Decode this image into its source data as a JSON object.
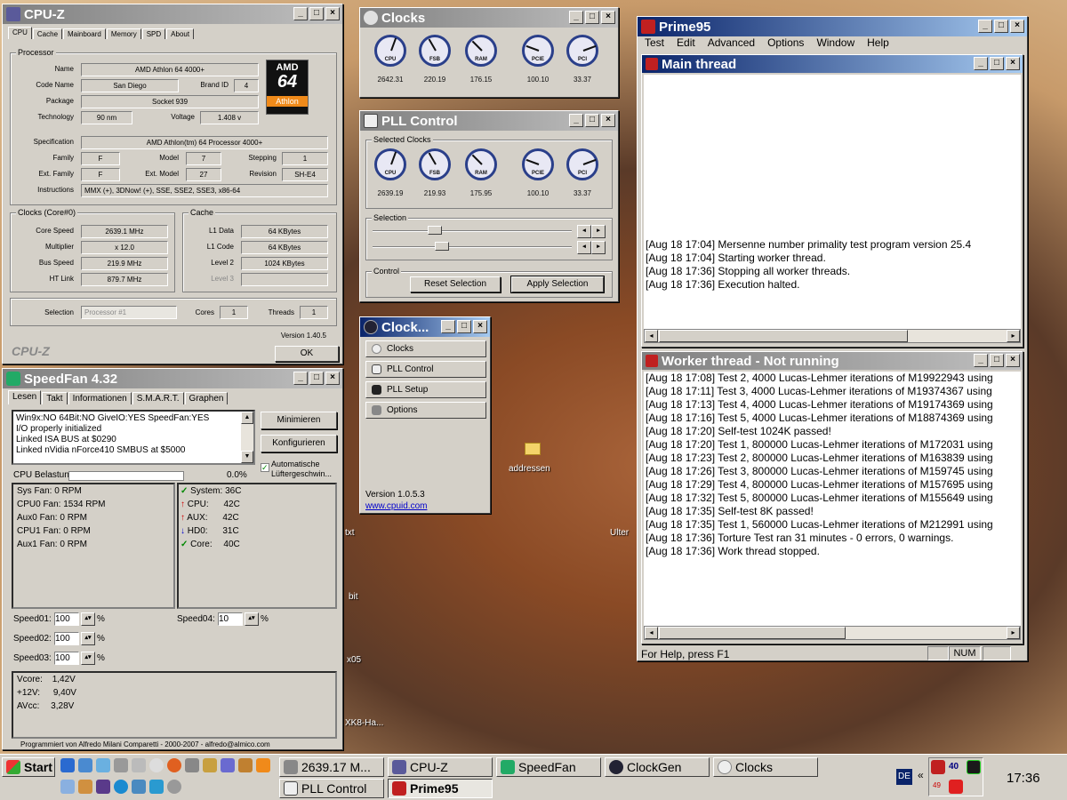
{
  "desktop": {
    "labels": [
      "addressen",
      "Ulter",
      "txt",
      "bit",
      "x05",
      "XK8-Ha..."
    ]
  },
  "cpuz": {
    "title": "CPU-Z",
    "tabs": [
      "CPU",
      "Cache",
      "Mainboard",
      "Memory",
      "SPD",
      "About"
    ],
    "processor_group": "Processor",
    "name_label": "Name",
    "name": "AMD Athlon 64 4000+",
    "codename_label": "Code Name",
    "codename": "San Diego",
    "brandid_label": "Brand ID",
    "brandid": "4",
    "package_label": "Package",
    "package": "Socket 939",
    "tech_label": "Technology",
    "tech": "90 nm",
    "voltage_label": "Voltage",
    "voltage": "1.408 v",
    "spec_label": "Specification",
    "spec": "AMD Athlon(tm) 64 Processor 4000+",
    "family_label": "Family",
    "family": "F",
    "model_label": "Model",
    "model": "7",
    "stepping_label": "Stepping",
    "stepping": "1",
    "extfamily_label": "Ext. Family",
    "extfamily": "F",
    "extmodel_label": "Ext. Model",
    "extmodel": "27",
    "revision_label": "Revision",
    "revision": "SH-E4",
    "instr_label": "Instructions",
    "instr": "MMX (+), 3DNow! (+), SSE, SSE2, SSE3, x86-64",
    "logo": {
      "brand": "AMD",
      "num": "64",
      "sub": "Athlon"
    },
    "clocks_group": "Clocks (Core#0)",
    "corespeed_label": "Core Speed",
    "corespeed": "2639.1 MHz",
    "mult_label": "Multiplier",
    "mult": "x 12.0",
    "bus_label": "Bus Speed",
    "bus": "219.9 MHz",
    "ht_label": "HT Link",
    "ht": "879.7 MHz",
    "cache_group": "Cache",
    "l1d_label": "L1 Data",
    "l1d": "64 KBytes",
    "l1c_label": "L1 Code",
    "l1c": "64 KBytes",
    "l2_label": "Level 2",
    "l2": "1024 KBytes",
    "l3_label": "Level 3",
    "selection_label": "Selection",
    "selection": "Processor #1",
    "cores_label": "Cores",
    "cores": "1",
    "threads_label": "Threads",
    "threads": "1",
    "version": "Version 1.40.5",
    "brand_footer": "CPU-Z",
    "ok": "OK"
  },
  "clocks": {
    "title": "Clocks",
    "gauges": [
      {
        "name": "CPU",
        "value": "2642.31"
      },
      {
        "name": "FSB",
        "value": "220.19"
      },
      {
        "name": "RAM",
        "value": "176.15"
      },
      {
        "name": "PCIE",
        "value": "100.10"
      },
      {
        "name": "PCI",
        "value": "33.37"
      }
    ]
  },
  "pll": {
    "title": "PLL Control",
    "selected_group": "Selected Clocks",
    "gauges": [
      {
        "name": "CPU",
        "value": "2639.19"
      },
      {
        "name": "FSB",
        "value": "219.93"
      },
      {
        "name": "RAM",
        "value": "175.95"
      },
      {
        "name": "PCIE",
        "value": "100.10"
      },
      {
        "name": "PCI",
        "value": "33.37"
      }
    ],
    "selection_group": "Selection",
    "control_group": "Control",
    "reset": "Reset Selection",
    "apply": "Apply Selection"
  },
  "clockgen": {
    "title": "Clock...",
    "items": [
      "Clocks",
      "PLL Control",
      "PLL Setup",
      "Options"
    ],
    "version": "Version 1.0.5.3",
    "link": "www.cpuid.com"
  },
  "speedfan": {
    "title": "SpeedFan 4.32",
    "tabs": [
      "Lesen",
      "Takt",
      "Informationen",
      "S.M.A.R.T.",
      "Graphen"
    ],
    "log": [
      "Win9x:NO 64Bit:NO GiveIO:YES SpeedFan:YES",
      "I/O properly initialized",
      "Linked ISA BUS at $0290",
      "Linked nVidia nForce410 SMBUS at $5000"
    ],
    "minimize": "Minimieren",
    "configure": "Konfigurieren",
    "auto_fan": "Automatische Lüftergeschwin...",
    "cpu_load_label": "CPU Belastung",
    "cpu_load": "0.0%",
    "fans": [
      {
        "label": "Sys Fan:",
        "value": "0 RPM"
      },
      {
        "label": "CPU0 Fan:",
        "value": "1534 RPM"
      },
      {
        "label": "Aux0 Fan:",
        "value": "0 RPM"
      },
      {
        "label": "CPU1 Fan:",
        "value": "0 RPM"
      },
      {
        "label": "Aux1 Fan:",
        "value": "0 RPM"
      }
    ],
    "temps": [
      {
        "label": "System:",
        "value": "36C",
        "icon": "check"
      },
      {
        "label": "CPU:",
        "value": "42C",
        "icon": "up"
      },
      {
        "label": "AUX:",
        "value": "42C",
        "icon": "up"
      },
      {
        "label": "HD0:",
        "value": "31C",
        "icon": "down"
      },
      {
        "label": "Core:",
        "value": "40C",
        "icon": "check"
      }
    ],
    "speeds": [
      {
        "label": "Speed01:",
        "value": "100"
      },
      {
        "label": "Speed02:",
        "value": "100"
      },
      {
        "label": "Speed03:",
        "value": "100"
      },
      {
        "label": "Speed04:",
        "value": "10"
      }
    ],
    "percent": "%",
    "volts": [
      {
        "label": "Vcore:",
        "value": "1,42V"
      },
      {
        "label": "+12V:",
        "value": "9,40V"
      },
      {
        "label": "AVcc:",
        "value": "3,28V"
      }
    ],
    "footer": "Programmiert von Alfredo Milani Comparetti - 2000-2007 - alfredo@almico.com"
  },
  "prime95": {
    "title": "Prime95",
    "menu": [
      "Test",
      "Edit",
      "Advanced",
      "Options",
      "Window",
      "Help"
    ],
    "main_title": "Main thread",
    "main_log": [
      "[Aug 18 17:04] Mersenne number primality test program version 25.4",
      "[Aug 18 17:04] Starting worker thread.",
      "[Aug 18 17:36] Stopping all worker threads.",
      "[Aug 18 17:36] Execution halted."
    ],
    "worker_title": "Worker thread - Not running",
    "worker_log": [
      "[Aug 18 17:08] Test 2, 4000 Lucas-Lehmer iterations of M19922943 using",
      "[Aug 18 17:11] Test 3, 4000 Lucas-Lehmer iterations of M19374367 using",
      "[Aug 18 17:13] Test 4, 4000 Lucas-Lehmer iterations of M19174369 using",
      "[Aug 18 17:16] Test 5, 4000 Lucas-Lehmer iterations of M18874369 using",
      "[Aug 18 17:20] Self-test 1024K passed!",
      "[Aug 18 17:20] Test 1, 800000 Lucas-Lehmer iterations of M172031 using",
      "[Aug 18 17:23] Test 2, 800000 Lucas-Lehmer iterations of M163839 using",
      "[Aug 18 17:26] Test 3, 800000 Lucas-Lehmer iterations of M159745 using",
      "[Aug 18 17:29] Test 4, 800000 Lucas-Lehmer iterations of M157695 using",
      "[Aug 18 17:32] Test 5, 800000 Lucas-Lehmer iterations of M155649 using",
      "[Aug 18 17:35] Self-test 8K passed!",
      "[Aug 18 17:35] Test 1, 560000 Lucas-Lehmer iterations of M212991 using",
      "[Aug 18 17:36] Torture Test ran 31 minutes - 0 errors, 0 warnings.",
      "[Aug 18 17:36] Work thread stopped."
    ],
    "status": "For Help, press F1",
    "num": "NUM"
  },
  "taskbar": {
    "start": "Start",
    "tasks_row1": [
      "2639.17 M...",
      "CPU-Z",
      "SpeedFan",
      "ClockGen",
      "Clocks"
    ],
    "tasks_row2": [
      "PLL Control",
      "Prime95"
    ],
    "lang": "DE",
    "tray_num1": "40",
    "tray_num2": "49",
    "clock": "17:36"
  },
  "colors": {
    "titlebar_active": "#0a246a",
    "window_face": "#d4d0c8",
    "gauge_ring": "#2a3f8a",
    "amd_orange": "#f08a1a"
  }
}
